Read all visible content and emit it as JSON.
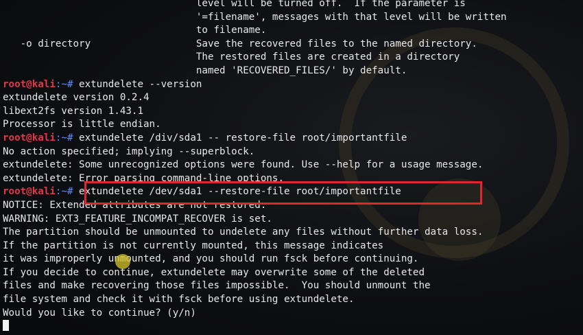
{
  "terminal": {
    "prompt": {
      "user_host": "root@kali",
      "path_suffix": ":~# "
    },
    "lines": [
      {
        "type": "text",
        "text": "                                 level will be turned off.  If the parameter is"
      },
      {
        "type": "text",
        "text": "                                 '=filename', messages with that level will be written"
      },
      {
        "type": "text",
        "text": "                                 to filename."
      },
      {
        "type": "text",
        "text": "   -o directory                  Save the recovered files to the named directory."
      },
      {
        "type": "text",
        "text": "                                 The restored files are created in a directory"
      },
      {
        "type": "text",
        "text": "                                 named 'RECOVERED_FILES/' by default."
      },
      {
        "type": "prompt",
        "command": "extundelete --version"
      },
      {
        "type": "text",
        "text": "extundelete version 0.2.4"
      },
      {
        "type": "text",
        "text": "libext2fs version 1.43.1"
      },
      {
        "type": "text",
        "text": "Processor is little endian."
      },
      {
        "type": "prompt",
        "command": "extundelete /div/sda1 -- restore-file root/importantfile"
      },
      {
        "type": "text",
        "text": "No action specified; implying --superblock."
      },
      {
        "type": "text",
        "text": "extundelete: Some unrecognized options were found. Use --help for a usage message."
      },
      {
        "type": "text",
        "text": "extundelete: Error parsing command-line options."
      },
      {
        "type": "prompt",
        "command": "extundelete /dev/sda1 --restore-file root/importantfile"
      },
      {
        "type": "text",
        "text": "NOTICE: Extended attributes are not restored."
      },
      {
        "type": "text",
        "text": "WARNING: EXT3_FEATURE_INCOMPAT_RECOVER is set."
      },
      {
        "type": "text",
        "text": "The partition should be unmounted to undelete any files without further data loss."
      },
      {
        "type": "text",
        "text": "If the partition is not currently mounted, this message indicates"
      },
      {
        "type": "text",
        "text": "it was improperly unmounted, and you should run fsck before continuing."
      },
      {
        "type": "text",
        "text": "If you decide to continue, extundelete may overwrite some of the deleted"
      },
      {
        "type": "text",
        "text": "files and make recovering those files impossible.  You should unmount the"
      },
      {
        "type": "text",
        "text": "file system and check it with fsck before using extundelete."
      },
      {
        "type": "text",
        "text": "Would you like to continue? (y/n)"
      },
      {
        "type": "cursor"
      }
    ],
    "colors": {
      "background": "#0e0f12",
      "text": "#e9e9e9",
      "prompt_user": "#e0384a",
      "prompt_path": "#5b8cff",
      "highlight_box": "#e0262f",
      "mouse_pointer": "#d6c428"
    }
  }
}
